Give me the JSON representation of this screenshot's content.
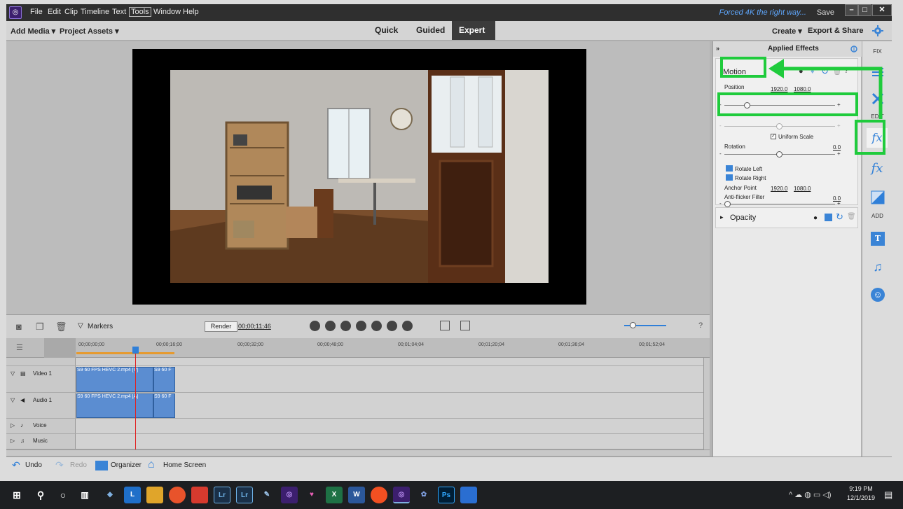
{
  "titlebar": {
    "app_logo": "◎",
    "menus": [
      "File",
      "Edit",
      "Clip",
      "Timeline",
      "Text",
      "Tools",
      "Window",
      "Help"
    ],
    "doc_title": "Forced 4K the right way...",
    "save_label": "Save",
    "minimize": "–",
    "maximize": "□",
    "close": "✕"
  },
  "modebar": {
    "add_media": "Add Media ▾",
    "project_assets": "Project Assets ▾",
    "modes": [
      "Quick",
      "Guided",
      "Expert"
    ],
    "active_mode": "Expert",
    "create": "Create ▾",
    "export_share": "Export & Share"
  },
  "effects": {
    "panel_title": "Applied Effects",
    "motion_label": "Motion",
    "position_label": "Position",
    "position_x": "1920.0",
    "position_y": "1080.0",
    "uniform_scale": "Uniform Scale",
    "rotation_label": "Rotation",
    "rotation_value": "0.0",
    "rotate_left": "Rotate Left",
    "rotate_right": "Rotate Right",
    "anchor_label": "Anchor Point",
    "anchor_x": "1920.0",
    "anchor_y": "1080.0",
    "antiflicker_label": "Anti-flicker Filter",
    "antiflicker_value": "0.0",
    "opacity_label": "Opacity",
    "minus": "-",
    "plus": "+"
  },
  "right_tools": {
    "fix_label": "FIX",
    "edit_label": "EDIT",
    "add_label": "ADD"
  },
  "timeline": {
    "markers_label": "Markers",
    "render_label": "Render",
    "timecode": "00;00;11;46",
    "ruler_ticks": [
      "00;00;00;00",
      "00;00;16;00",
      "00;00;32;00",
      "00;00;48;00",
      "00;01;04;04",
      "00;01;20;04",
      "00;01;36;04",
      "00;01;52;04"
    ],
    "video_track_label": "Video 1",
    "audio_track_label": "Audio 1",
    "voice_track_label": "Voice",
    "music_track_label": "Music",
    "video_clip_label": "S9 60 FPS HEVC 2.mp4 [V]",
    "video_clip2_label": "S9 60 F",
    "audio_clip_label": "S9 60 FPS HEVC 2.mp4 [A]",
    "audio_clip2_label": "S9 60 F"
  },
  "bottombar": {
    "undo": "Undo",
    "redo": "Redo",
    "organizer": "Organizer",
    "home_screen": "Home Screen"
  },
  "taskbar": {
    "time": "9:19 PM",
    "date": "12/1/2019",
    "app_labels": [
      "L",
      "Lr",
      "Lr",
      "X",
      "W",
      "Ps"
    ]
  },
  "colors": {
    "highlight": "#1fcb3c",
    "accent_blue": "#2f7fd8"
  }
}
